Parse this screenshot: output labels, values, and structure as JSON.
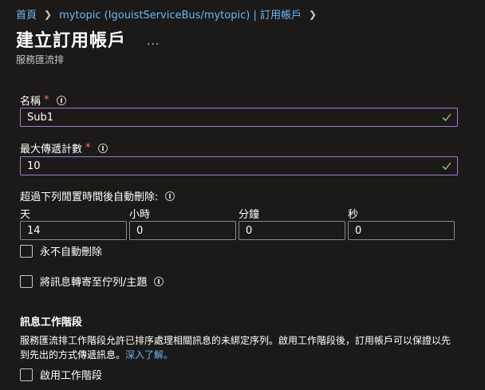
{
  "breadcrumb": {
    "home": "首頁",
    "parent": "mytopic (IgouistServiceBus/mytopic) | 訂用帳戶"
  },
  "header": {
    "title": "建立訂用帳戶",
    "more": "...",
    "subtitle": "服務匯流排"
  },
  "form": {
    "name": {
      "label": "名稱",
      "required_mark": "*",
      "value": "Sub1"
    },
    "max_delivery": {
      "label": "最大傳遞計數",
      "required_mark": "*",
      "value": "10"
    },
    "auto_delete": {
      "label": "超過下列閒置時間後自動刪除:",
      "columns": [
        {
          "label": "天",
          "value": "14"
        },
        {
          "label": "小時",
          "value": "0"
        },
        {
          "label": "分鐘",
          "value": "0"
        },
        {
          "label": "秒",
          "value": "0"
        }
      ],
      "never_label": "永不自動刪除"
    },
    "forward": {
      "label": "將訊息轉寄至佇列/主題"
    }
  },
  "sessions": {
    "heading": "訊息工作階段",
    "description": "服務匯流排工作階段允許已排序處理相關訊息的未綁定序列。啟用工作階段後，訂用帳戶可以保證以先到先出的方式傳遞訊息。",
    "learn_more": "深入了解。",
    "enable_label": "啟用工作階段"
  },
  "icons": {
    "info": "info-icon",
    "check": "checkmark-icon",
    "chevron": "chevron-right-icon"
  },
  "colors": {
    "accent": "#a079d6",
    "link": "#6cb8f6",
    "valid": "#8fd48f",
    "required": "#f1707b"
  }
}
